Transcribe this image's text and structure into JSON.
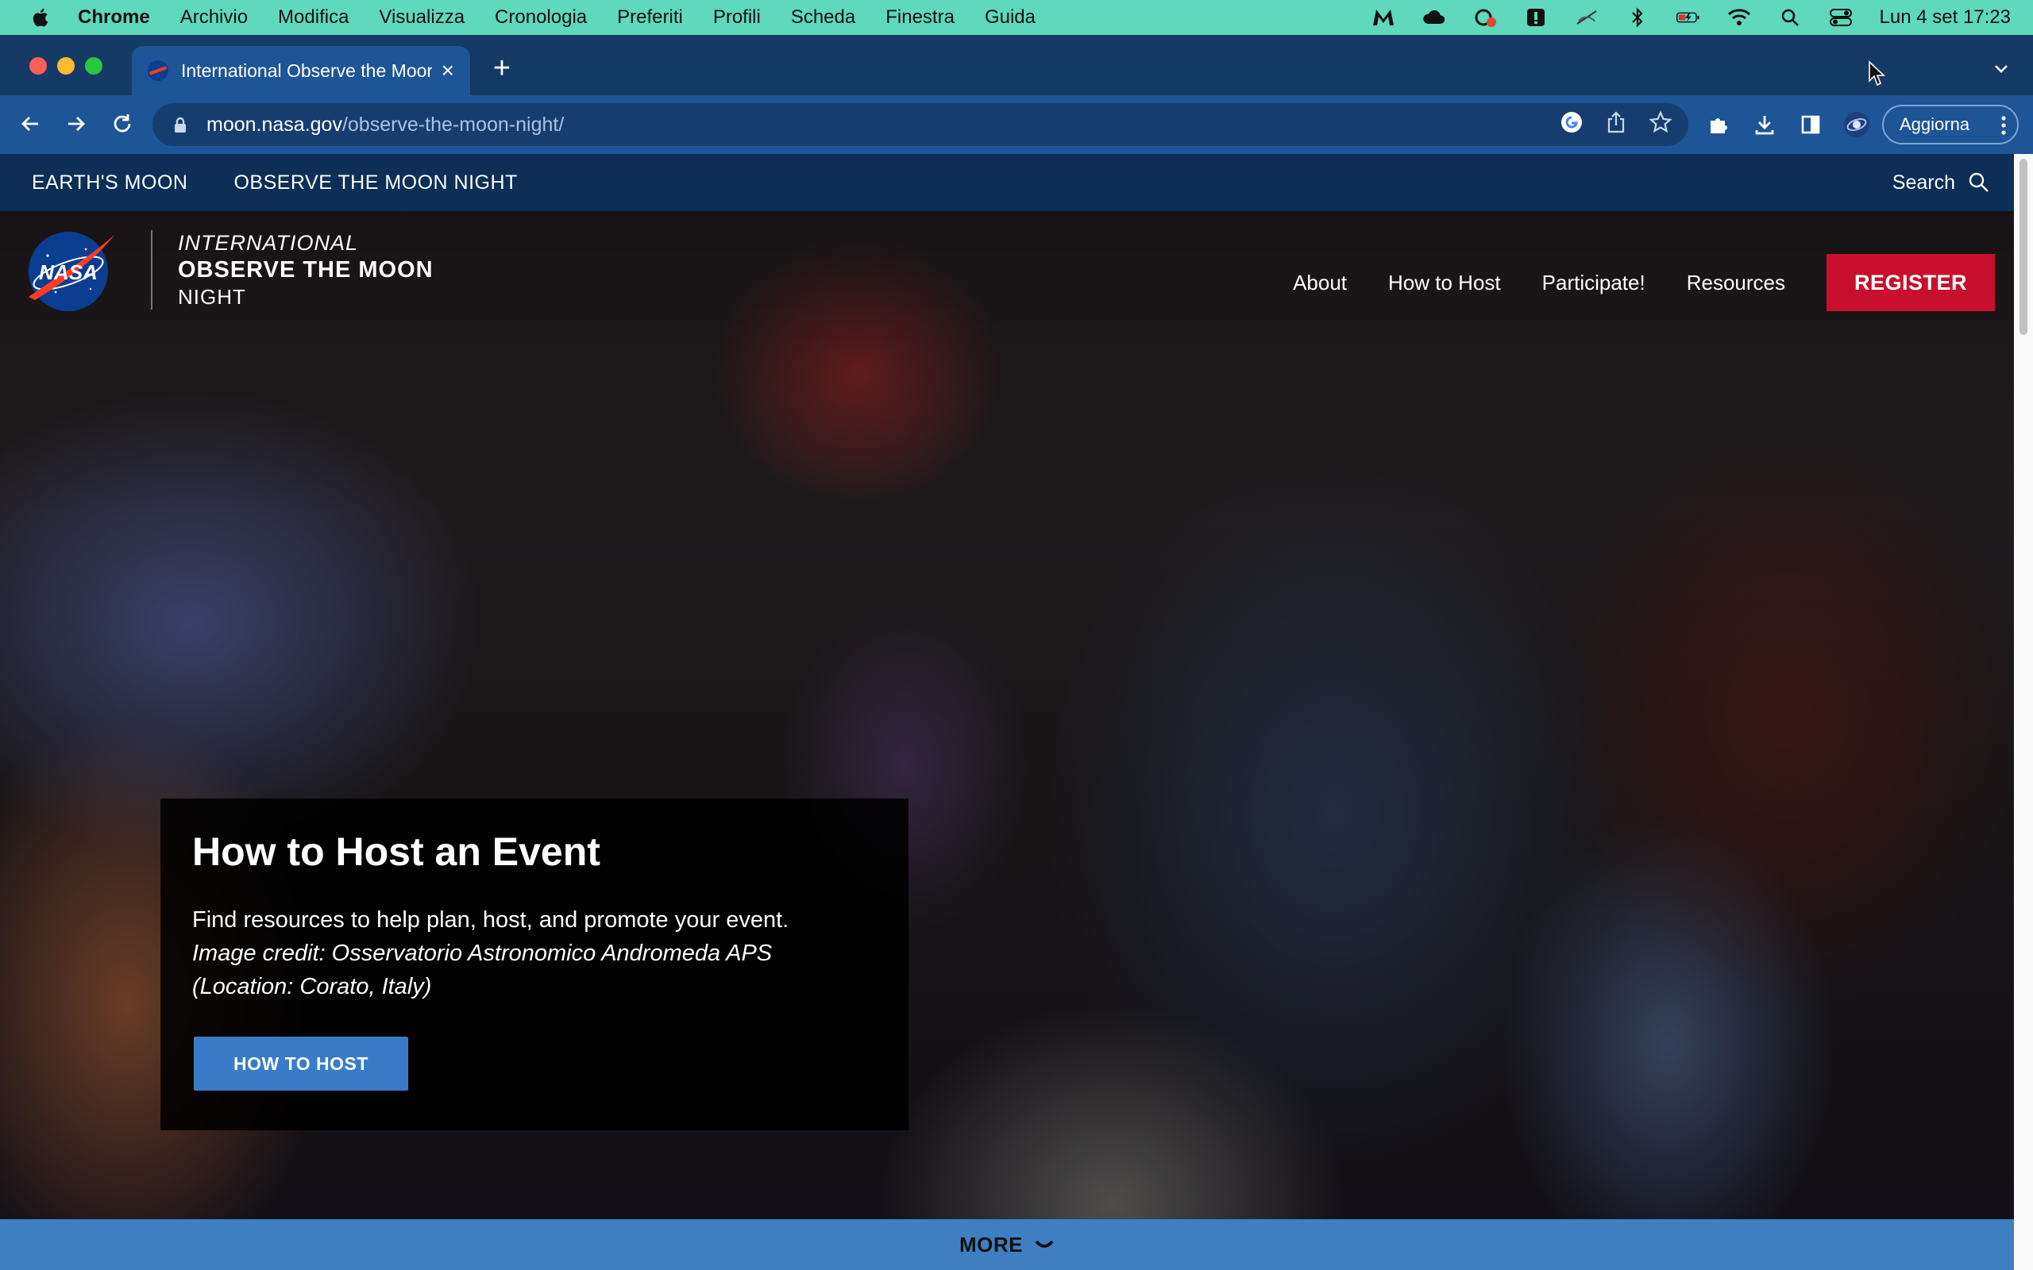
{
  "menubar": {
    "app_name": "Chrome",
    "items": [
      "Archivio",
      "Modifica",
      "Visualizza",
      "Cronologia",
      "Preferiti",
      "Profili",
      "Scheda",
      "Finestra",
      "Guida"
    ],
    "clock": "Lun 4 set  17:23",
    "status_icons": [
      "malwarebytes-icon",
      "cloud-icon",
      "creative-cloud-icon",
      "notification-icon",
      "mute-icon",
      "bluetooth-icon",
      "battery-icon",
      "wifi-icon",
      "spotlight-icon",
      "control-center-icon"
    ]
  },
  "browser": {
    "tab_title": "International Observe the Moon",
    "url_host": "moon.nasa.gov",
    "url_path": "/observe-the-moon-night/",
    "update_label": "Aggiorna"
  },
  "page": {
    "subnav": {
      "items": [
        "EARTH'S MOON",
        "OBSERVE THE MOON NIGHT"
      ],
      "search_label": "Search"
    },
    "brand": {
      "logo_text": "NASA",
      "line1": "INTERNATIONAL",
      "line2": "OBSERVE THE MOON",
      "line3": "NIGHT"
    },
    "nav": {
      "items": [
        "About",
        "How to Host",
        "Participate!",
        "Resources"
      ],
      "register": "REGISTER"
    },
    "hero_card": {
      "title": "How to Host an Event",
      "description": "Find resources to help plan, host, and promote your event.",
      "credit": "Image credit: Osservatorio Astronomico Andromeda APS (Location: Corato, Italy)",
      "button": "HOW TO HOST"
    },
    "more_label": "MORE"
  },
  "colors": {
    "menubar": "#5fd8bd",
    "tab_strip": "#163a66",
    "toolbar": "#1d5596",
    "subnav": "#0c2e57",
    "register": "#c8102e",
    "host_button": "#3a7bc8",
    "more_bar": "#3f7fc1"
  }
}
